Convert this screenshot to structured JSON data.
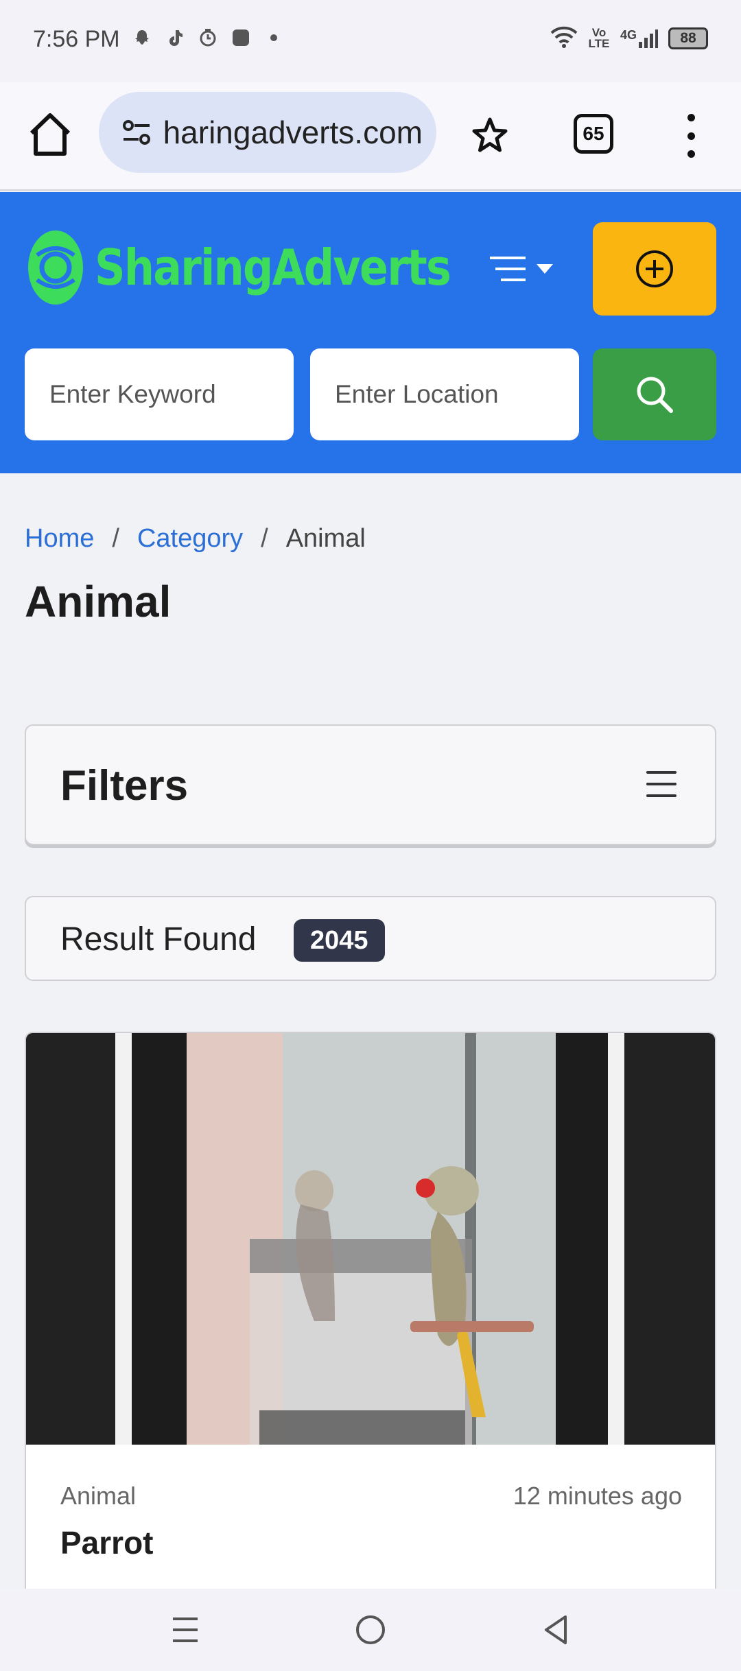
{
  "status_bar": {
    "time": "7:56 PM",
    "notification_icons": [
      "snapchat-icon",
      "tiktok-icon",
      "timer-icon",
      "app-icon",
      "dot-icon"
    ],
    "network": "Vo LTE",
    "signal": "4G",
    "battery": "88"
  },
  "browser": {
    "url": "sharingadverts.com",
    "tab_count": "65"
  },
  "site": {
    "logo_text_1": "Sharing",
    "logo_text_2": "Adverts",
    "brand_color": "#2672e9",
    "accent_color": "#fbb511",
    "search": {
      "keyword_placeholder": "Enter Keyword",
      "location_placeholder": "Enter Location"
    }
  },
  "breadcrumb": {
    "home": "Home",
    "sep": "/",
    "category": "Category",
    "current": "Animal"
  },
  "page": {
    "title": "Animal",
    "filters_title": "Filters",
    "result_label": "Result Found",
    "result_count": "2045"
  },
  "listing": {
    "category": "Animal",
    "time_ago": "12 minutes ago",
    "title": "Parrot"
  }
}
